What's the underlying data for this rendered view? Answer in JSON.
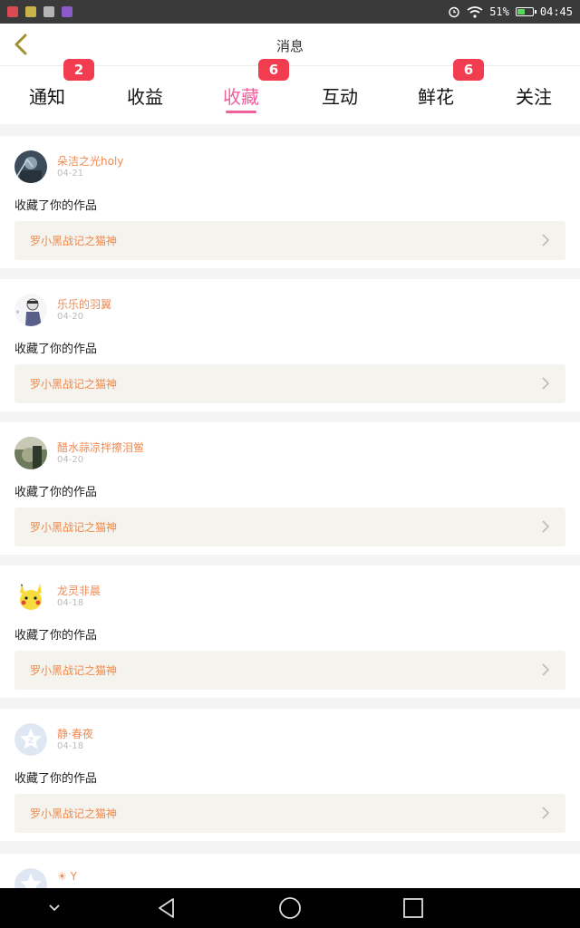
{
  "status_bar": {
    "battery_percent": "51%",
    "time": "04:45",
    "battery_level": 0.51,
    "app_icon_colors": [
      "#d94b54",
      "#c8b24a",
      "#b4b4b4",
      "#8a5ac8"
    ]
  },
  "header": {
    "title": "消息",
    "back_icon": "chevron-left-icon"
  },
  "tabs": [
    {
      "label": "通知",
      "badge": "2"
    },
    {
      "label": "收益",
      "badge": ""
    },
    {
      "label": "收藏",
      "badge": "6",
      "active": true
    },
    {
      "label": "互动",
      "badge": ""
    },
    {
      "label": "鲜花",
      "badge": "6"
    },
    {
      "label": "关注",
      "badge": ""
    }
  ],
  "colors": {
    "accent": "#f0609a",
    "badge": "#f23c50",
    "username": "#ee8a52",
    "work_title": "#ef8a4c"
  },
  "items": [
    {
      "user": "朵洁之光holy",
      "date": "04-21",
      "action": "收藏了你的作品",
      "work": "罗小黑战记之猫神",
      "avatar": "photo-avatar-dark"
    },
    {
      "user": "乐乐的羽翼",
      "date": "04-20",
      "action": "收藏了你的作品",
      "work": "罗小黑战记之猫神",
      "avatar": "anime-avatar"
    },
    {
      "user": "醋水蒜凉拌擦泪鲎",
      "date": "04-20",
      "action": "收藏了你的作品",
      "work": "罗小黑战记之猫神",
      "avatar": "photo-avatar-green"
    },
    {
      "user": "龙灵非晨",
      "date": "04-18",
      "action": "收藏了你的作品",
      "work": "罗小黑战记之猫神",
      "avatar": "pikachu-avatar"
    },
    {
      "user": "静·春夜",
      "date": "04-18",
      "action": "收藏了你的作品",
      "work": "罗小黑战记之猫神",
      "avatar": "default-star-avatar"
    }
  ],
  "partial_item": {
    "user": "☀ Y",
    "avatar": "default-star-avatar"
  },
  "nav_bar": [
    "chevron-down-icon",
    "back-triangle-icon",
    "home-circle-icon",
    "recents-square-icon"
  ]
}
